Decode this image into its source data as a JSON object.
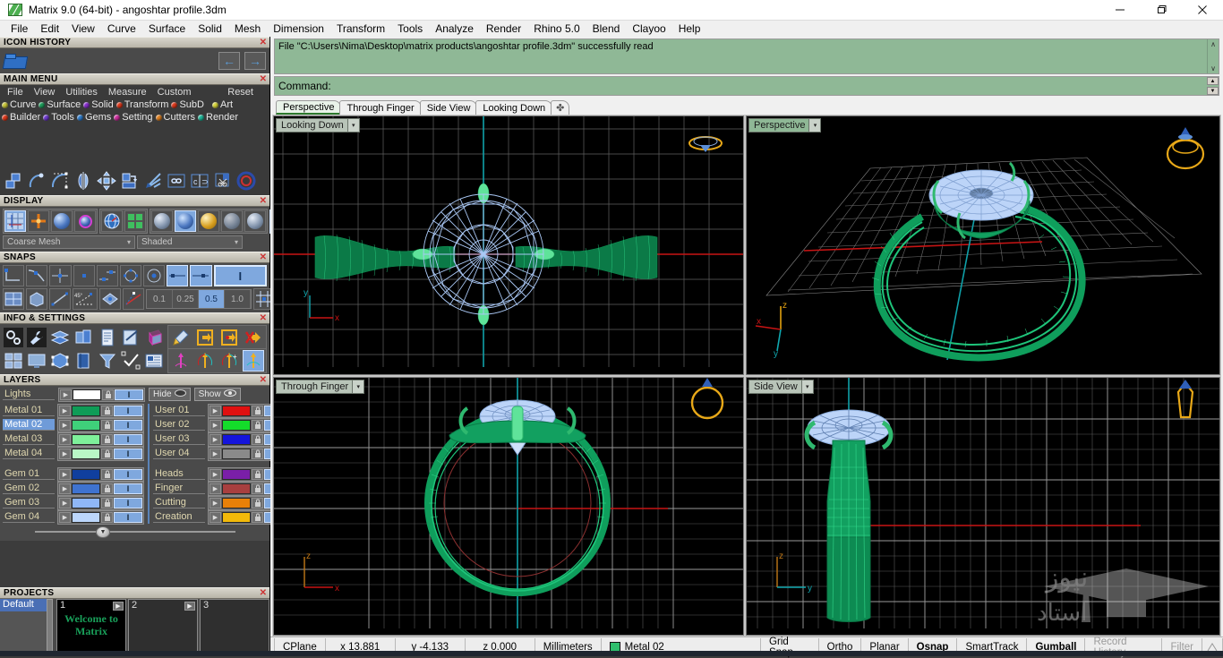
{
  "window": {
    "title": "Matrix 9.0 (64-bit) - angoshtar profile.3dm",
    "minimize": "—",
    "maximize": "❐",
    "close": "✕"
  },
  "menubar": {
    "items": [
      "File",
      "Edit",
      "View",
      "Curve",
      "Surface",
      "Solid",
      "Mesh",
      "Dimension",
      "Transform",
      "Tools",
      "Analyze",
      "Render",
      "Rhino 5.0",
      "Blend",
      "Clayoo",
      "Help"
    ]
  },
  "panels": {
    "icon_history": {
      "title": "ICON HISTORY",
      "close": "✕",
      "back": "←",
      "forward": "→"
    },
    "main_menu": {
      "title": "MAIN MENU",
      "close": "✕",
      "row1": [
        "File",
        "View",
        "Utilities",
        "Measure",
        "Custom"
      ],
      "reset": "Reset",
      "row2": [
        {
          "label": "Curve",
          "color": "#c9c63a"
        },
        {
          "label": "Surface",
          "color": "#1d9c5a"
        },
        {
          "label": "Solid",
          "color": "#8a2fd0"
        },
        {
          "label": "Transform",
          "color": "#e0391c"
        },
        {
          "label": "SubD",
          "color": "#e0391c"
        },
        {
          "label": "Art",
          "color": "#d8d63c"
        }
      ],
      "row3": [
        {
          "label": "Builder",
          "color": "#e0391c"
        },
        {
          "label": "Tools",
          "color": "#6f3ad0"
        },
        {
          "label": "Gems",
          "color": "#2f7fd0"
        },
        {
          "label": "Setting",
          "color": "#d02fa0"
        },
        {
          "label": "Cutters",
          "color": "#e08020"
        },
        {
          "label": "Render",
          "color": "#1fb89a"
        }
      ]
    },
    "display": {
      "title": "DISPLAY",
      "close": "✕",
      "mesh_value": "Coarse Mesh",
      "mode_value": "Shaded",
      "caret": "▾"
    },
    "snaps": {
      "title": "SNAPS",
      "close": "✕",
      "tolerances": [
        "0.1",
        "0.25",
        "0.5",
        "1.0"
      ],
      "tolerance_selected": "0.5"
    },
    "info_settings": {
      "title": "INFO & SETTINGS",
      "close": "✕"
    },
    "layers": {
      "title": "LAYERS",
      "close": "✕",
      "lights_label": "Lights",
      "lights_color": "#ffffff",
      "hide_label": "Hide",
      "show_label": "Show",
      "on_mark": "I",
      "lock_mark": "␣",
      "arrow_mark": "▶",
      "col_left": [
        {
          "label": "Metal 01",
          "color": "#0f9c57",
          "selected": false
        },
        {
          "label": "Metal 02",
          "color": "#3fd07a",
          "selected": true
        },
        {
          "label": "Metal 03",
          "color": "#7ef09a",
          "selected": false
        },
        {
          "label": "Metal 04",
          "color": "#b9f7c6",
          "selected": false
        },
        {
          "label": "Gem 01",
          "color": "#103f9e",
          "selected": false
        },
        {
          "label": "Gem 02",
          "color": "#3f73d0",
          "selected": false
        },
        {
          "label": "Gem 03",
          "color": "#8fb7f7",
          "selected": false
        },
        {
          "label": "Gem 04",
          "color": "#bcd6fb",
          "selected": false
        }
      ],
      "col_right": [
        {
          "label": "User 01",
          "color": "#e01010",
          "selected": false
        },
        {
          "label": "User 02",
          "color": "#14dc2a",
          "selected": false
        },
        {
          "label": "User 03",
          "color": "#1414dc",
          "selected": false
        },
        {
          "label": "User 04",
          "color": "#8a8a8a",
          "selected": false
        },
        {
          "label": "Heads",
          "color": "#7a1fa8",
          "selected": false
        },
        {
          "label": "Finger",
          "color": "#a83f3f",
          "selected": false
        },
        {
          "label": "Cutting",
          "color": "#e88008",
          "selected": false
        },
        {
          "label": "Creation",
          "color": "#f2b90a",
          "selected": false
        }
      ]
    },
    "projects": {
      "title": "PROJECTS",
      "close": "✕",
      "items": [
        "Default"
      ],
      "slides": [
        {
          "number": "1",
          "caption_line1": "Welcome to",
          "caption_line2": "Matrix"
        },
        {
          "number": "2",
          "caption_line1": "",
          "caption_line2": ""
        },
        {
          "number": "3",
          "caption_line1": "",
          "caption_line2": ""
        }
      ]
    }
  },
  "command_area": {
    "history": "File \"C:\\Users\\Nima\\Desktop\\matrix products\\angoshtar profile.3dm\" successfully read",
    "prompt": "Command:",
    "prompt_value": "",
    "scroll_up": "∧",
    "scroll_down": "∨"
  },
  "view_tabs": {
    "items": [
      "Perspective",
      "Through Finger",
      "Side View",
      "Looking Down"
    ],
    "active": "Perspective",
    "add": "✤"
  },
  "viewports": [
    {
      "name": "Looking Down",
      "active": false,
      "caret": "▾",
      "axes": [
        "y",
        "x"
      ]
    },
    {
      "name": "Perspective",
      "active": true,
      "caret": "▾",
      "axes": [
        "z",
        "x",
        "y"
      ]
    },
    {
      "name": "Through Finger",
      "active": false,
      "caret": "▾",
      "axes": [
        "z",
        "x"
      ]
    },
    {
      "name": "Side View",
      "active": false,
      "caret": "▾",
      "axes": [
        "z",
        "y"
      ]
    }
  ],
  "statusbar": {
    "cplane": "CPlane",
    "x": "x 13.881",
    "y": "y -4.133",
    "z": "z 0.000",
    "units": "Millimeters",
    "layer": "Metal 02",
    "layer_color": "#2fbf6d",
    "toggles": [
      {
        "label": "Grid Snap",
        "on": false
      },
      {
        "label": "Ortho",
        "on": false
      },
      {
        "label": "Planar",
        "on": false
      },
      {
        "label": "Osnap",
        "on": true
      },
      {
        "label": "SmartTrack",
        "on": false
      },
      {
        "label": "Gumball",
        "on": true
      },
      {
        "label": "Record History",
        "on": false,
        "dim": true
      },
      {
        "label": "Filter",
        "on": false,
        "dim": true
      }
    ]
  },
  "watermark": {
    "text1": "نیوز",
    "text2": "استاد"
  }
}
